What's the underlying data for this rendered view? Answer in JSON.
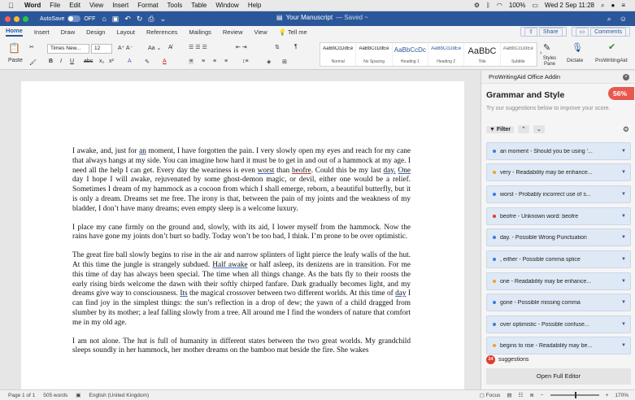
{
  "menubar": {
    "app": "Word",
    "items": [
      "File",
      "Edit",
      "View",
      "Insert",
      "Format",
      "Tools",
      "Table",
      "Window",
      "Help"
    ],
    "battery": "100%",
    "datetime": "Wed 2 Sep  11:28"
  },
  "titlebar": {
    "autosave_label": "AutoSave",
    "autosave_state": "OFF",
    "doc_title": "Your Manuscript",
    "saved_status": "— Saved ~"
  },
  "tabs": {
    "items": [
      "Home",
      "Insert",
      "Draw",
      "Design",
      "Layout",
      "References",
      "Mailings",
      "Review",
      "View"
    ],
    "tell_me": "Tell me",
    "share": "Share",
    "comments": "Comments"
  },
  "ribbon": {
    "paste_label": "Paste",
    "font_name": "Times New...",
    "font_size": "12",
    "styles": [
      {
        "preview": "AaBbCcDdEe",
        "name": "Normal"
      },
      {
        "preview": "AaBbCcDdEe",
        "name": "No Spacing"
      },
      {
        "preview": "AaBbCcDc",
        "name": "Heading 1"
      },
      {
        "preview": "AaBbCcDdEe",
        "name": "Heading 2"
      },
      {
        "preview": "AaBbC",
        "name": "Title"
      },
      {
        "preview": "AaBbCcDdEe",
        "name": "Subtitle"
      }
    ],
    "styles_pane": "Styles Pane",
    "dictate": "Dictate",
    "prowritingaid": "ProWritingAid"
  },
  "document": {
    "p1": {
      "a": "I awake, and, just for ",
      "b": "an",
      "c": " moment, I have forgotten the pain. I very slowly open my eyes and reach for my cane that always hangs at my side. You can imagine how hard it must be to get in and out of a hammock at my age. I need all the help I can get. Every day the weariness is even ",
      "d": "worst",
      "e": " than ",
      "f": "beofre",
      "g": ". Could this be my last ",
      "h": "day.",
      "i": " ",
      "j": "One",
      "k": " day I hope I will awake, rejuvenated by some ghost-demon magic, or devil, either one would be a relief. Sometimes I dream of my hammock as a cocoon from which I shall emerge, reborn, a beautiful butterfly, but it is only a dream. Dreams set me free. The irony is that, between the pain of my joints and the weakness of my bladder, I don’t have many dreams; even empty sleep is a welcome luxury."
    },
    "p2": "I place my cane firmly on the ground and, slowly, with its aid, I lower myself from the hammock. Now the rains have gone my joints don’t hurt so badly. Today won’t be too bad, I think. I’m prone to be over optimistic.",
    "p3": {
      "a": "The great fire ball slowly begins to rise in the air and narrow splinters of light pierce the leafy walls of the hut. At this time the jungle is strangely subdued. ",
      "b": "Half awake",
      "c": " or half asleep, its denizens are in transition. For me this time of day has always been special. The time when all things change. As the bats fly to their roosts the early rising birds welcome the dawn with their softly chirped fanfare. Dark gradually becomes light, and my dreams give way to consciousness. ",
      "d": "Its",
      "e": " the magical crossover between two different worlds. At this time of ",
      "f": "day",
      "g": " I can find joy in the simplest things: the sun’s reflection in a drop of dew; the yawn of a child dragged from slumber by its mother; a leaf falling slowly from a tree. All around me I find the wonders of nature that comfort me in my old age."
    },
    "p4": "I am not alone. The hut is full of humanity in different states between the two great worlds. My grandchild sleeps soundly in her hammock, her mother dreams on the bamboo mat beside the fire. She wakes"
  },
  "sidebar": {
    "header": "ProWritingAid Office Addin",
    "title": "Grammar and Style",
    "score": "56%",
    "subtitle": "Try our suggestions below to improve your score.",
    "filter_label": "Filter",
    "suggestions": [
      {
        "text": "an moment  -  Should you be using '...",
        "color": "#3a7be0"
      },
      {
        "text": "very  -  Readability may be enhance...",
        "color": "#f0a030"
      },
      {
        "text": "worst  -  Probably incorrect use of s...",
        "color": "#3a7be0"
      },
      {
        "text": "beofre  -  Unknown word: beofre",
        "color": "#e03a2e"
      },
      {
        "text": "day.  -  Possible Wrong Punctuation",
        "color": "#3a7be0"
      },
      {
        "text": ", either  -  Possible comma splice",
        "color": "#3a7be0"
      },
      {
        "text": "one  -  Readability may be enhance...",
        "color": "#f0a030"
      },
      {
        "text": "gone  -  Possible missing comma",
        "color": "#3a7be0"
      },
      {
        "text": "over optimistic  -  Possible confuse...",
        "color": "#3a7be0"
      },
      {
        "text": "begins to rise  -  Readability may be...",
        "color": "#f0a030"
      }
    ],
    "count": "24",
    "count_label": "suggestions",
    "open_full": "Open Full Editor"
  },
  "statusbar": {
    "page": "Page 1 of 1",
    "words": "505 words",
    "language": "English (United Kingdom)",
    "focus": "Focus",
    "zoom": "170%"
  },
  "colors": {
    "accent": "#2b579a",
    "score_bg": "#e8584f"
  }
}
